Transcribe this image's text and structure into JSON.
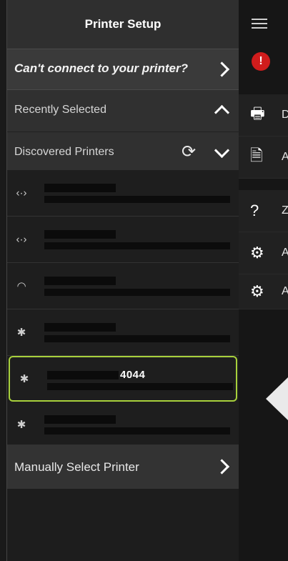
{
  "header": {
    "title": "Printer Setup"
  },
  "help": {
    "label": "Can't connect to your printer?"
  },
  "sections": {
    "recent": {
      "label": "Recently Selected"
    },
    "discovered": {
      "label": "Discovered Printers"
    }
  },
  "printers": [
    {
      "icon": "network-icon",
      "name": "",
      "selected": false
    },
    {
      "icon": "network-icon",
      "name": "",
      "selected": false
    },
    {
      "icon": "wifi-icon",
      "name": "",
      "selected": false
    },
    {
      "icon": "bluetooth-icon",
      "name": "",
      "selected": false
    },
    {
      "icon": "bluetooth-icon",
      "name": "4044",
      "selected": true
    },
    {
      "icon": "bluetooth-icon",
      "name": "",
      "selected": false
    }
  ],
  "manual": {
    "label": "Manually Select Printer"
  },
  "background_app": {
    "rows": [
      {
        "icon": "printer-icon",
        "text": "D"
      },
      {
        "icon": "document-icon",
        "text": "A"
      },
      {
        "icon": "help-icon",
        "text": "Z"
      },
      {
        "icon": "gear-icon",
        "text": "A"
      },
      {
        "icon": "printer-settings-icon",
        "text": "A"
      }
    ]
  },
  "colors": {
    "selected_border": "#a8d13c",
    "error": "#d01c1c"
  }
}
